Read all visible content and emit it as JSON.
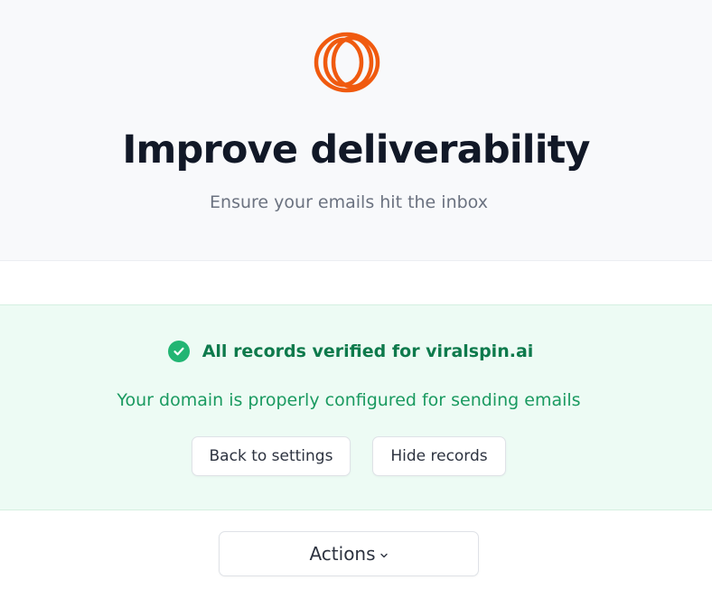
{
  "header": {
    "logo_icon": "rings-logo-icon",
    "title": "Improve deliverability",
    "subtitle": "Ensure your emails hit the inbox"
  },
  "status_banner": {
    "icon": "check-circle-icon",
    "headline": "All records verified for viralspin.ai",
    "description": "Your domain is properly configured for sending emails",
    "buttons": {
      "back_label": "Back to settings",
      "hide_label": "Hide records"
    }
  },
  "actions": {
    "label": "Actions",
    "icon": "chevron-down-icon"
  },
  "colors": {
    "brand": "#f05a0f",
    "success": "#22b573",
    "success_text": "#0e7a4c",
    "banner_bg": "#edfbf4"
  }
}
